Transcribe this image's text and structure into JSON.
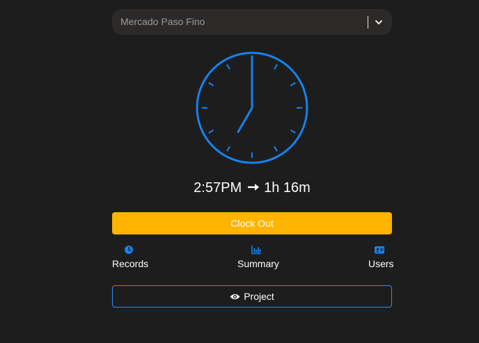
{
  "project_select": {
    "value": "Mercado Paso Fino"
  },
  "clock": {
    "hour": 7,
    "minute": 0
  },
  "status": {
    "time": "2:57PM",
    "duration": "1h 16m"
  },
  "actions": {
    "clock_out_label": "Clock Out",
    "project_label": "Project"
  },
  "nav": {
    "records": {
      "label": "Records",
      "icon": "clock-icon"
    },
    "summary": {
      "label": "Summary",
      "icon": "bar-chart-icon"
    },
    "users": {
      "label": "Users",
      "icon": "id-card-icon"
    }
  },
  "colors": {
    "background": "#1e1d1d",
    "accent_blue": "#1483f0",
    "clock_out_yellow": "#ffb400",
    "select_bg": "#2b2a29"
  }
}
